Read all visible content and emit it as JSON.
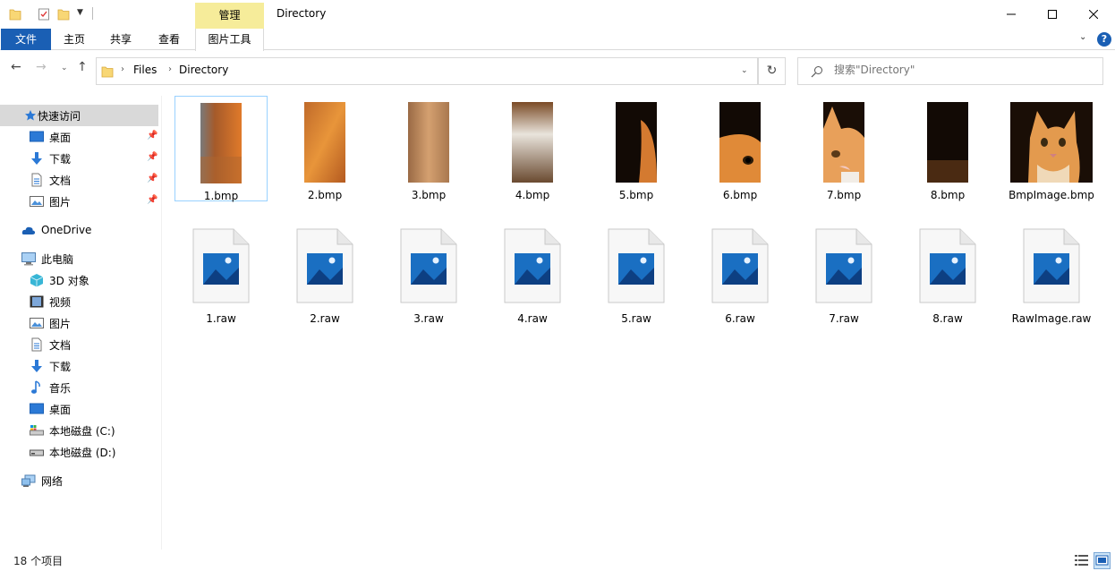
{
  "window": {
    "title": "Directory",
    "context_tab_group": "管理"
  },
  "ribbon": {
    "tabs": [
      {
        "label": "文件"
      },
      {
        "label": "主页"
      },
      {
        "label": "共享"
      },
      {
        "label": "查看"
      },
      {
        "label": "图片工具"
      }
    ],
    "help": "?"
  },
  "address": {
    "breadcrumb": [
      "Files",
      "Directory"
    ],
    "search_placeholder": "搜索\"Directory\""
  },
  "sidebar": {
    "quick_access": {
      "label": "快速访问",
      "items": [
        {
          "label": "桌面",
          "icon": "desktop-icon",
          "pinned": true
        },
        {
          "label": "下载",
          "icon": "download-icon",
          "pinned": true
        },
        {
          "label": "文档",
          "icon": "document-icon",
          "pinned": true
        },
        {
          "label": "图片",
          "icon": "picture-icon",
          "pinned": true
        }
      ]
    },
    "onedrive": {
      "label": "OneDrive"
    },
    "this_pc": {
      "label": "此电脑",
      "items": [
        {
          "label": "3D 对象",
          "icon": "3d-objects-icon"
        },
        {
          "label": "视频",
          "icon": "video-icon"
        },
        {
          "label": "图片",
          "icon": "picture-icon"
        },
        {
          "label": "文档",
          "icon": "document-icon"
        },
        {
          "label": "下载",
          "icon": "download-icon"
        },
        {
          "label": "音乐",
          "icon": "music-icon"
        },
        {
          "label": "桌面",
          "icon": "desktop-icon"
        },
        {
          "label": "本地磁盘 (C:)",
          "icon": "drive-c-icon"
        },
        {
          "label": "本地磁盘 (D:)",
          "icon": "drive-d-icon"
        }
      ]
    },
    "network": {
      "label": "网络"
    }
  },
  "files": {
    "bmp": [
      {
        "name": "1.bmp",
        "thumb": "cat-strip-1"
      },
      {
        "name": "2.bmp",
        "thumb": "cat-strip-2"
      },
      {
        "name": "3.bmp",
        "thumb": "cat-strip-3"
      },
      {
        "name": "4.bmp",
        "thumb": "cat-strip-4"
      },
      {
        "name": "5.bmp",
        "thumb": "cat-strip-5"
      },
      {
        "name": "6.bmp",
        "thumb": "cat-strip-6"
      },
      {
        "name": "7.bmp",
        "thumb": "cat-strip-7"
      },
      {
        "name": "8.bmp",
        "thumb": "cat-strip-8"
      },
      {
        "name": "BmpImage.bmp",
        "thumb": "cat-full"
      }
    ],
    "raw": [
      {
        "name": "1.raw"
      },
      {
        "name": "2.raw"
      },
      {
        "name": "3.raw"
      },
      {
        "name": "4.raw"
      },
      {
        "name": "5.raw"
      },
      {
        "name": "6.raw"
      },
      {
        "name": "7.raw"
      },
      {
        "name": "8.raw"
      },
      {
        "name": "RawImage.raw"
      }
    ]
  },
  "status": {
    "item_count": "18 个项目"
  },
  "colors": {
    "file_tab": "#1a5fb4",
    "context_tab": "#f6ec9a",
    "selection": "#99d1ff"
  }
}
